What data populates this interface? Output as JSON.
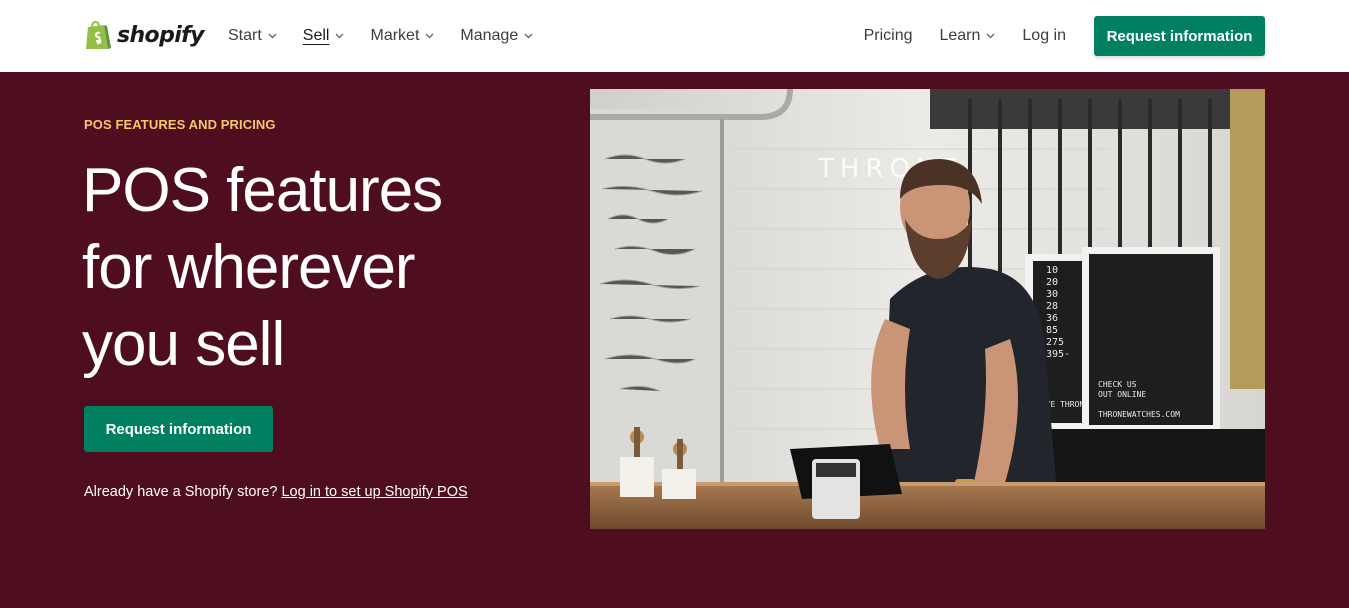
{
  "header": {
    "logo_text": "shopify",
    "nav_left": [
      {
        "label": "Start",
        "active": false
      },
      {
        "label": "Sell",
        "active": true
      },
      {
        "label": "Market",
        "active": false
      },
      {
        "label": "Manage",
        "active": false
      }
    ],
    "nav_right": {
      "pricing": "Pricing",
      "learn": "Learn",
      "login": "Log in",
      "cta": "Request information"
    }
  },
  "hero": {
    "eyebrow": "POS FEATURES AND PRICING",
    "headline_lines": [
      "POS features",
      "for wherever",
      "you sell"
    ],
    "cta": "Request information",
    "already_text": "Already have a Shopify store?",
    "already_link": "Log in to set up Shopify POS"
  },
  "photo": {
    "neon_sign": "THRONE",
    "letterboard_left": [
      "10",
      "20",
      "30",
      "28",
      "36",
      "85",
      "275",
      "395-"
    ],
    "letterboard_left_bottom": "LOVE THRONE",
    "letterboard_right": [
      "CHECK US",
      "OUT ONLINE",
      "THRONEWATCHES.COM"
    ]
  },
  "colors": {
    "hero_background": "#4f0e20",
    "accent_green": "#008060",
    "eyebrow_gold": "#f1c86a"
  },
  "icons": {
    "logo": "shopify-bag-icon",
    "dropdown": "chevron-down-icon"
  }
}
